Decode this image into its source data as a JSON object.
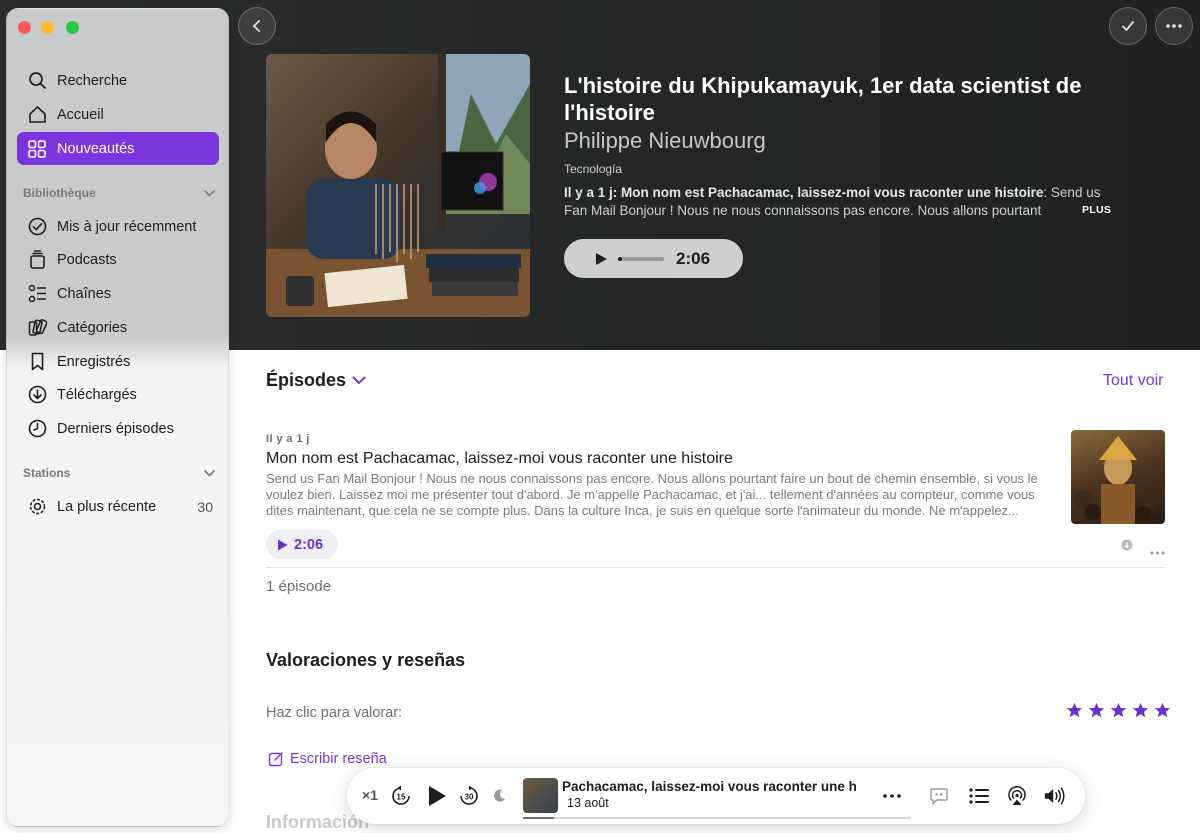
{
  "sidebar": {
    "nav": [
      {
        "label": "Recherche",
        "icon": "search-icon"
      },
      {
        "label": "Accueil",
        "icon": "home-icon"
      },
      {
        "label": "Nouveautés",
        "icon": "grid-icon",
        "active": true
      }
    ],
    "library_label": "Bibliothèque",
    "library": [
      {
        "label": "Mis à jour récemment",
        "icon": "checkmark-circle-icon"
      },
      {
        "label": "Podcasts",
        "icon": "podcast-stack-icon"
      },
      {
        "label": "Chaînes",
        "icon": "channels-icon"
      },
      {
        "label": "Catégories",
        "icon": "categories-icon"
      },
      {
        "label": "Enregistrés",
        "icon": "bookmark-icon"
      },
      {
        "label": "Téléchargés",
        "icon": "download-icon"
      },
      {
        "label": "Derniers épisodes",
        "icon": "clock-icon"
      }
    ],
    "stations_label": "Stations",
    "stations": [
      {
        "label": "La plus récente",
        "icon": "gear-icon",
        "count": "30"
      }
    ]
  },
  "hero": {
    "title": "L'histoire du Khipukamayuk, 1er data scientist de l'histoire",
    "author": "Philippe Nieuwbourg",
    "category": "Tecnología",
    "desc_prefix": "Il y a 1 j: Mon nom est Pachacamac, laissez-moi vous raconter une histoire",
    "desc_rest": ": Send us Fan Mail  Bonjour ! Nous ne nous connaissons pas encore. Nous allons pourtant",
    "more_label": "PLUS",
    "play_time": "2:06",
    "progress": 0.08
  },
  "episodes": {
    "header": "Épisodes",
    "see_all": "Tout voir",
    "items": [
      {
        "date": "Il y a 1 j",
        "title": "Mon nom est Pachacamac, laissez-moi vous raconter une histoire",
        "description": "Send us Fan Mail  Bonjour ! Nous ne nous connaissons pas encore. Nous allons pourtant faire un bout de chemin ensemble, si vous le voulez bien. Laissez moi me présenter tout d'abord.  Je m'appelle Pachacamac, et j'ai... tellement d'années au compteur, comme vous dites maintenant, que cela ne se compte plus. Dans la culture Inca, je suis en quelque sorte l'animateur du monde. Ne m'appelez...",
        "duration": "2:06"
      }
    ],
    "count_label": "1 épisode"
  },
  "ratings": {
    "title": "Valoraciones y reseñas",
    "rate_label": "Haz clic para valorar:",
    "stars": 5,
    "write_review": "Escribir reseña"
  },
  "info_title": "Información",
  "player": {
    "rate": "×1",
    "skip_back": "15",
    "skip_forward": "30",
    "title": "Pachacamac, laissez-moi vous raconter une h",
    "date": "13 août",
    "progress": 0.08
  },
  "colors": {
    "accent": "#7a35dc",
    "star": "#6a2fd0",
    "close": "#ff5f57",
    "minimize": "#febc2e",
    "zoom": "#28c840"
  }
}
